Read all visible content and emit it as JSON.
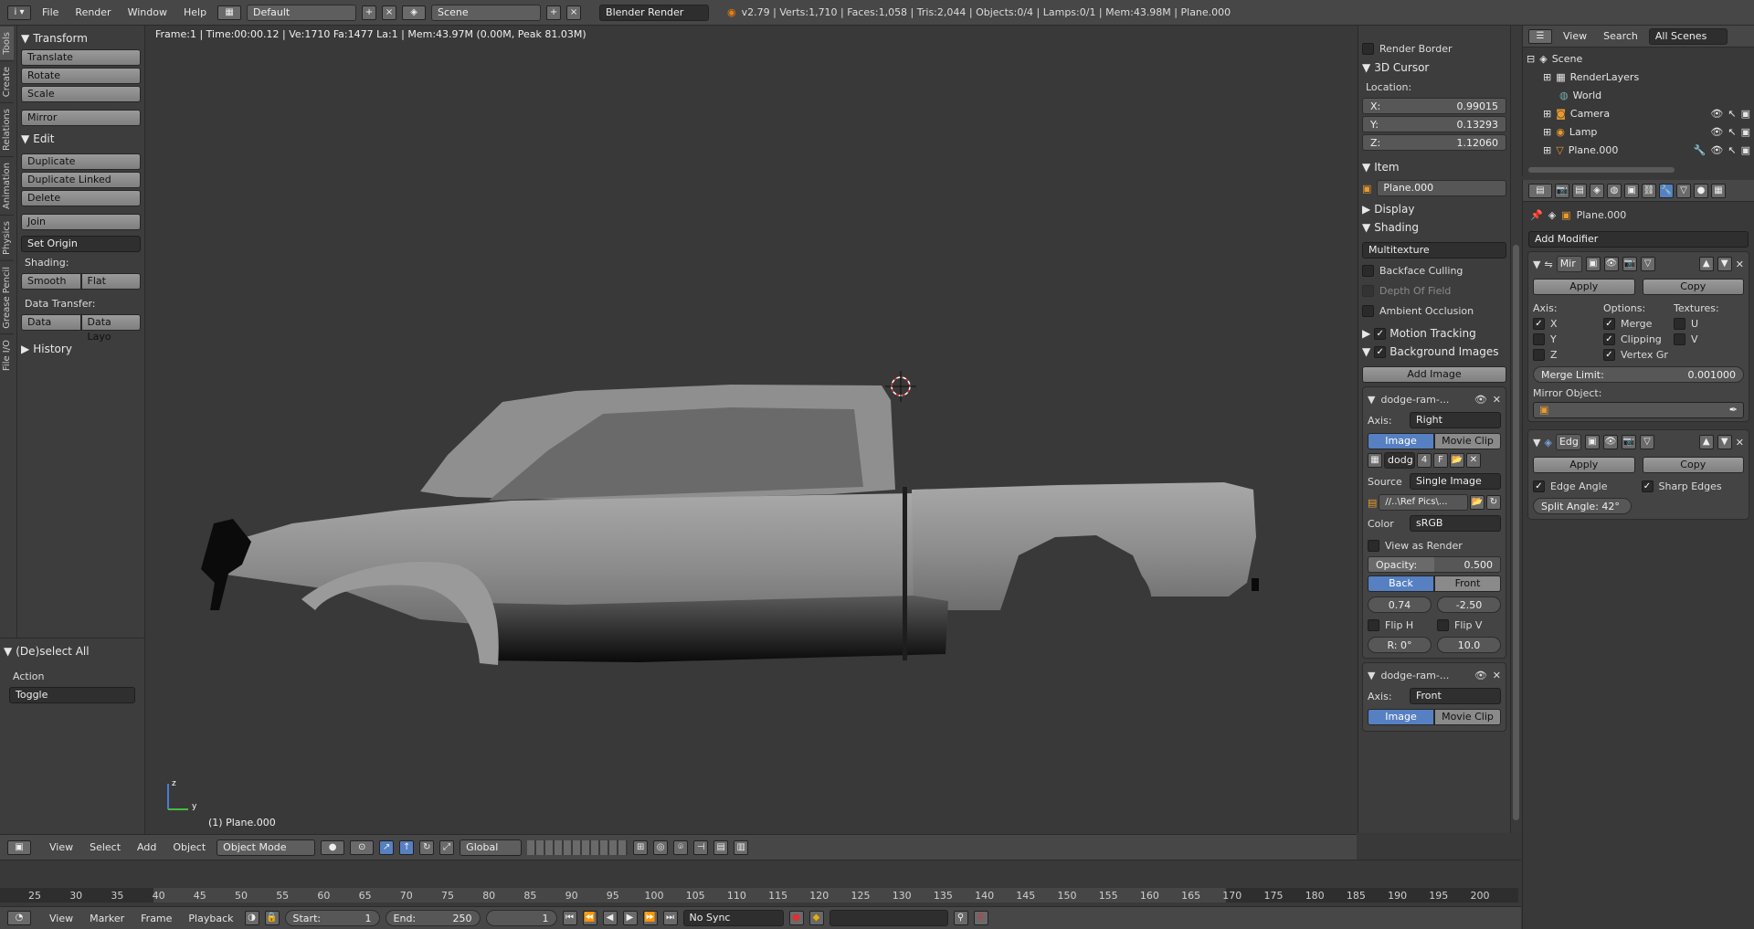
{
  "topbar": {
    "menus": [
      "File",
      "Render",
      "Window",
      "Help"
    ],
    "layout": "Default",
    "scene": "Scene",
    "engine": "Blender Render",
    "stats": "v2.79 | Verts:1,710 | Faces:1,058 | Tris:2,044 | Objects:0/4 | Lamps:0/1 | Mem:43.98M | Plane.000"
  },
  "tabs": [
    "Tools",
    "Create",
    "Relations",
    "Animation",
    "Physics",
    "Grease Pencil",
    "File I/O"
  ],
  "toolshelf": {
    "transform_title": "Transform",
    "translate": "Translate",
    "rotate": "Rotate",
    "scale": "Scale",
    "mirror": "Mirror",
    "edit_title": "Edit",
    "duplicate": "Duplicate",
    "duplicate_linked": "Duplicate Linked",
    "delete": "Delete",
    "join": "Join",
    "set_origin": "Set Origin",
    "shading_label": "Shading:",
    "smooth": "Smooth",
    "flat": "Flat",
    "data_transfer_label": "Data Transfer:",
    "data": "Data",
    "data_layo": "Data Layo",
    "history": "History"
  },
  "redo": {
    "title": "(De)select All",
    "action_label": "Action",
    "action_value": "Toggle"
  },
  "viewport": {
    "info": "Frame:1 | Time:00:00.12 | Ve:1710 Fa:1477 La:1 | Mem:43.97M (0.00M, Peak 81.03M)",
    "object_label": "(1) Plane.000",
    "axis_z": "z",
    "axis_y": "y"
  },
  "viewheader": {
    "view": "View",
    "select": "Select",
    "add": "Add",
    "object": "Object",
    "mode": "Object Mode",
    "orientation": "Global"
  },
  "timeline": {
    "ticks": [
      "25",
      "30",
      "35",
      "40",
      "45",
      "50",
      "55",
      "60",
      "65",
      "70",
      "75",
      "80",
      "85",
      "90",
      "95",
      "100",
      "105",
      "110",
      "115",
      "120",
      "125",
      "130",
      "135",
      "140",
      "145",
      "150",
      "155",
      "160",
      "165",
      "170",
      "175",
      "180",
      "185",
      "190",
      "195",
      "200"
    ],
    "view": "View",
    "marker": "Marker",
    "frame": "Frame",
    "playback": "Playback",
    "start_label": "Start:",
    "start": "1",
    "end_label": "End:",
    "end": "250",
    "current": "1",
    "sync": "No Sync"
  },
  "npanel": {
    "render_border": "Render Border",
    "cursor_title": "3D Cursor",
    "location": "Location:",
    "x_label": "X:",
    "x": "0.99015",
    "y_label": "Y:",
    "y": "0.13293",
    "z_label": "Z:",
    "z": "1.12060",
    "item_title": "Item",
    "item_name": "Plane.000",
    "display": "Display",
    "shading": "Shading",
    "shading_mode": "Multitexture",
    "backface": "Backface Culling",
    "dof": "Depth Of Field",
    "ao": "Ambient Occlusion",
    "motion_tracking": "Motion Tracking",
    "bg_images": "Background Images",
    "add_image": "Add Image",
    "bg1": {
      "name": "dodge-ram-...",
      "axis_label": "Axis:",
      "axis": "Right",
      "image": "Image",
      "movie": "Movie Clip",
      "img_name": "dodg",
      "users": "4",
      "fake": "F",
      "source_label": "Source",
      "source": "Single Image",
      "path": "//..\\Ref Pics\\...",
      "color_label": "Color",
      "color": "sRGB",
      "view_as_render": "View as Render",
      "opacity_label": "Opacity:",
      "opacity": "0.500",
      "back": "Back",
      "front": "Front",
      "ox": "0.74",
      "oy": "-2.50",
      "fliph": "Flip H",
      "flipv": "Flip V",
      "rot": "R: 0°",
      "size": "10.0"
    },
    "bg2": {
      "name": "dodge-ram-...",
      "axis_label": "Axis:",
      "axis": "Front",
      "image": "Image",
      "movie": "Movie Clip"
    }
  },
  "outliner": {
    "view": "View",
    "search": "Search",
    "filter": "All Scenes",
    "items": [
      "Scene",
      "RenderLayers",
      "World",
      "Camera",
      "Lamp",
      "Plane.000"
    ]
  },
  "props": {
    "object_name": "Plane.000",
    "add_modifier": "Add Modifier",
    "mirror": {
      "name": "Mir",
      "apply": "Apply",
      "copy": "Copy",
      "axis": "Axis:",
      "options": "Options:",
      "textures": "Textures:",
      "x": "X",
      "y": "Y",
      "z": "Z",
      "merge": "Merge",
      "clipping": "Clipping",
      "vertex": "Vertex Gr",
      "u": "U",
      "v": "V",
      "merge_limit_label": "Merge Limit:",
      "merge_limit": "0.001000",
      "mirror_object": "Mirror Object:"
    },
    "edge": {
      "name": "Edg",
      "apply": "Apply",
      "copy": "Copy",
      "edge_angle": "Edge Angle",
      "sharp_edges": "Sharp Edges",
      "split_angle": "Split Angle: 42°"
    }
  },
  "colors": {
    "accent": "#5680c2",
    "bg": "#393939",
    "header": "#474747"
  }
}
